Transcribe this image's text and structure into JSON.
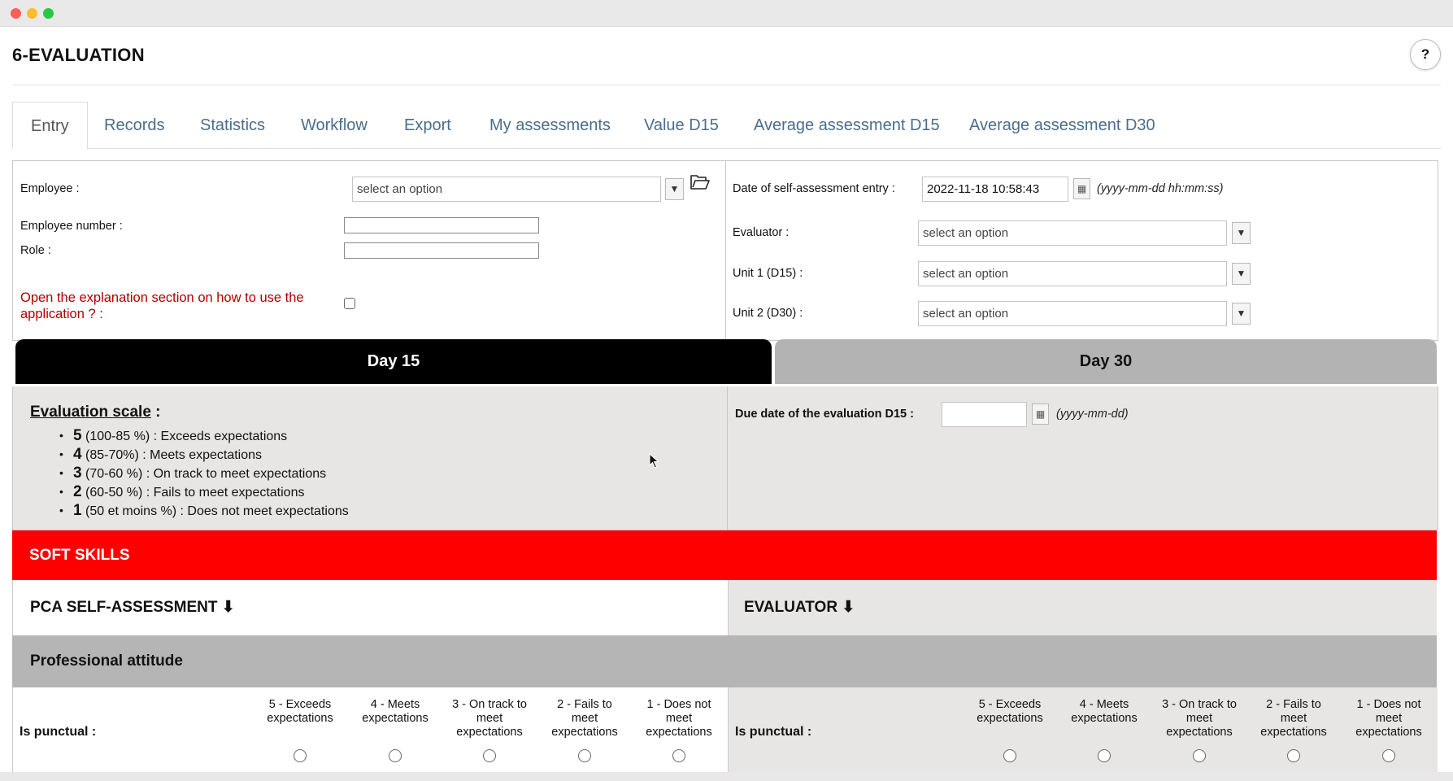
{
  "window": {
    "buttons": {
      "close_color": "#ff5f57",
      "minimize_color": "#febc2e",
      "maximize_color": "#28c840"
    }
  },
  "app": {
    "title": "6-EVALUATION",
    "help_label": "?"
  },
  "tabs": [
    {
      "label": "Entry",
      "active": true
    },
    {
      "label": "Records"
    },
    {
      "label": "Statistics"
    },
    {
      "label": "Workflow"
    },
    {
      "label": "Export"
    },
    {
      "label": "My assessments"
    },
    {
      "label": "Value D15"
    },
    {
      "label": "Average assessment D15"
    },
    {
      "label": "Average assessment D30"
    }
  ],
  "form": {
    "employee_label": "Employee :",
    "employee_placeholder": "select an option",
    "employee_number_label": "Employee number :",
    "employee_number_value": "",
    "role_label": "Role :",
    "role_value": "",
    "explanation_label_line1": "Open the explanation section on how to use the",
    "explanation_label_line2": "application ? :",
    "date_label": "Date of self-assessment entry :",
    "date_value": "2022-11-18 10:58:43",
    "date_hint": "(yyyy-mm-dd hh:mm:ss)",
    "evaluator_label": "Evaluator :",
    "evaluator_placeholder": "select an option",
    "unit1_label": "Unit 1 (D15) :",
    "unit1_placeholder": "select an option",
    "unit2_label": "Unit 2 (D30) :",
    "unit2_placeholder": "select an option"
  },
  "day_tabs": [
    {
      "label": "Day 15",
      "active": true
    },
    {
      "label": "Day 30",
      "active": false
    }
  ],
  "scale": {
    "title": "Evaluation scale",
    "title_suffix": " :",
    "items": [
      {
        "num": "5",
        "range": " (100-85 %) : ",
        "text": "Exceeds expectations"
      },
      {
        "num": "4",
        "range": " (85-70%) : ",
        "text": "Meets expectations"
      },
      {
        "num": "3",
        "range": " (70-60 %) : ",
        "text": "On track to meet expectations"
      },
      {
        "num": "2",
        "range": " (60-50 %) : ",
        "text": "Fails to meet expectations"
      },
      {
        "num": "1",
        "range": " (50 et moins %) : ",
        "text": "Does not meet expectations"
      }
    ],
    "due_date_label": "Due date of the evaluation D15 :",
    "due_date_value": "",
    "due_date_hint": "(yyyy-mm-dd)"
  },
  "sections": {
    "soft_skills": "SOFT SKILLS",
    "self_assessment": "PCA SELF-ASSESSMENT ⬇",
    "evaluator": "EVALUATOR ⬇",
    "professional_attitude": "Professional attitude"
  },
  "rating": {
    "question": "Is punctual :",
    "options": [
      {
        "line1": "5 - Exceeds",
        "line2": "expectations",
        "line3": ""
      },
      {
        "line1": "4 - Meets",
        "line2": "expectations",
        "line3": ""
      },
      {
        "line1": "3 - On track to",
        "line2": "meet",
        "line3": "expectations"
      },
      {
        "line1": "2 - Fails to",
        "line2": "meet",
        "line3": "expectations"
      },
      {
        "line1": "1 - Does not",
        "line2": "meet",
        "line3": "expectations"
      }
    ]
  },
  "colors": {
    "tab_text": "#4a6d8c",
    "explanation_text": "#b00000",
    "soft_skills_bg": "#ff0000",
    "day_active_bg": "#000000",
    "day_inactive_bg": "#b3b3b3",
    "panel_bg": "#e8e6e4",
    "section_gray": "#b5b5b5"
  },
  "icons": {
    "folder": "open-folder-icon",
    "calendar": "calendar-icon",
    "dropdown": "chevron-down-icon",
    "cursor": "mouse-pointer-icon"
  }
}
